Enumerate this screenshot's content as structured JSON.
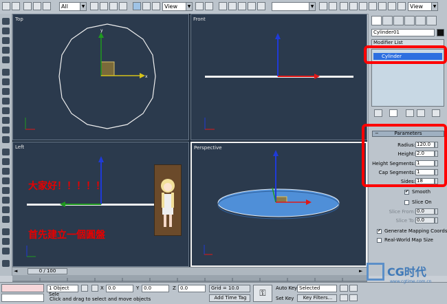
{
  "toolbar": {
    "selection_filter": "All",
    "coordinate_system": "View",
    "named_selection": "",
    "render_view": "View"
  },
  "viewports": {
    "top": {
      "label": "Top"
    },
    "front": {
      "label": "Front"
    },
    "left": {
      "label": "Left"
    },
    "perspective": {
      "label": "Perspective"
    }
  },
  "axes": {
    "x": "x",
    "y": "y",
    "z": "z"
  },
  "overlay_text": {
    "greeting": "大家好！！！！！",
    "instruction": "首先建立一個圓盤"
  },
  "timeline": {
    "frame": "0 / 100"
  },
  "status": {
    "selection": "1 Object Sele",
    "x_label": "X",
    "x_value": "0.0",
    "y_label": "Y",
    "y_value": "0.0",
    "z_label": "Z",
    "z_value": "0.0",
    "grid": "Grid = 10.0",
    "prompt": "Click and drag to select and move objects",
    "add_time_tag": "Add Time Tag",
    "auto_key": "Auto Key",
    "auto_key_mode": "Selected",
    "set_key": "Set Key",
    "key_filters": "Key Filters..."
  },
  "command_panel": {
    "object_name": "Cylinder01",
    "modifier_list": "Modifier List",
    "modifier_stack": [
      "Cylinder"
    ],
    "parameters_title": "Parameters",
    "parameters": [
      {
        "label": "Radius:",
        "value": "120.0"
      },
      {
        "label": "Height:",
        "value": "2.0"
      },
      {
        "label": "Height Segments:",
        "value": "1"
      },
      {
        "label": "Cap Segments:",
        "value": "1"
      },
      {
        "label": "Sides:",
        "value": "18"
      }
    ],
    "options": [
      {
        "label": "Smooth",
        "checked": true,
        "enabled": true
      },
      {
        "label": "Slice On",
        "checked": false,
        "enabled": true
      }
    ],
    "slice_from": {
      "label": "Slice From:",
      "value": "0.0"
    },
    "slice_to": {
      "label": "Slice To:",
      "value": "0.0"
    },
    "mapping": [
      {
        "label": "Generate Mapping Coords.",
        "checked": true
      },
      {
        "label": "Real-World Map Size",
        "checked": false
      }
    ]
  },
  "watermark": {
    "brand": "CG时代",
    "url": "www.cgtime.com.cn"
  },
  "colors": {
    "viewport_bg": "#2b3a4d",
    "annotation_red": "#ff0000",
    "disc_blue": "#4f8fd8",
    "axis_y_green": "#1f9a1f",
    "axis_z_blue": "#1f3ad8",
    "axis_x_red": "#e01818"
  }
}
